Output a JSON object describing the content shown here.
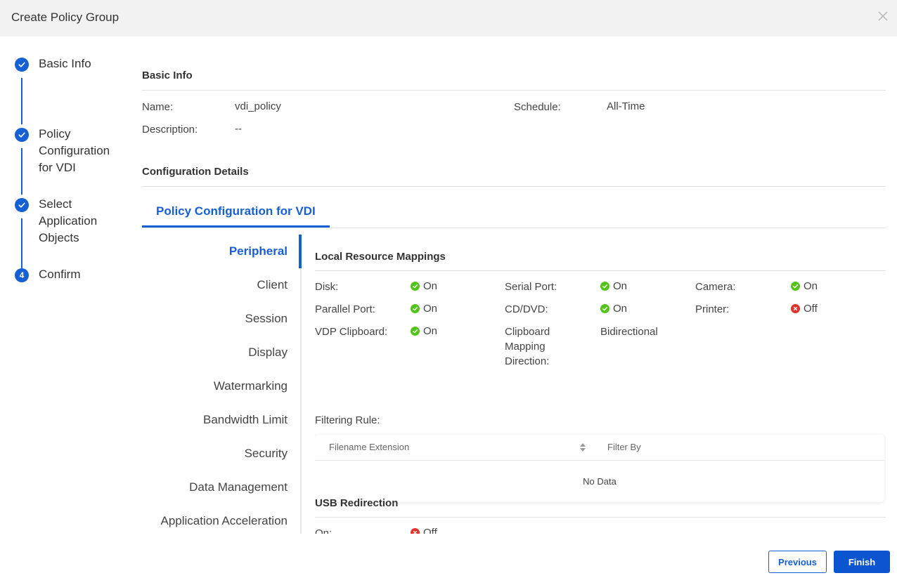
{
  "dialog": {
    "title": "Create Policy Group",
    "close_icon": "close-icon"
  },
  "steps": [
    {
      "label": "Basic Info",
      "state": "done",
      "icon": "check-icon"
    },
    {
      "label": "Policy Configuration for VDI",
      "state": "done",
      "icon": "check-icon"
    },
    {
      "label": "Select Application Objects",
      "state": "done",
      "icon": "check-icon"
    },
    {
      "label": "Confirm",
      "state": "current",
      "number": "4"
    }
  ],
  "basic_info": {
    "title": "Basic Info",
    "name_label": "Name:",
    "name_value": "vdi_policy",
    "schedule_label": "Schedule:",
    "schedule_value": "All-Time",
    "description_label": "Description:",
    "description_value": "--"
  },
  "config_details": {
    "title": "Configuration Details",
    "tab": "Policy Configuration for VDI"
  },
  "side_menu": {
    "items": [
      "Peripheral",
      "Client",
      "Session",
      "Display",
      "Watermarking",
      "Bandwidth Limit",
      "Security",
      "Data Management",
      "Application Acceleration"
    ],
    "active": "Peripheral"
  },
  "local_resource_mappings": {
    "title": "Local Resource Mappings",
    "disk_label": "Disk:",
    "disk_value": "On",
    "serial_port_label": "Serial Port:",
    "serial_port_value": "On",
    "camera_label": "Camera:",
    "camera_value": "On",
    "parallel_port_label": "Parallel Port:",
    "parallel_port_value": "On",
    "cd_dvd_label": "CD/DVD:",
    "cd_dvd_value": "On",
    "printer_label": "Printer:",
    "printer_value": "Off",
    "vdp_clipboard_label": "VDP Clipboard:",
    "vdp_clipboard_value": "On",
    "clipboard_direction_label": "Clipboard Mapping Direction:",
    "clipboard_direction_value": "Bidirectional",
    "filtering_rule_label": "Filtering Rule:",
    "table": {
      "columns": [
        "Filename Extension",
        "Filter By"
      ],
      "empty_text": "No Data",
      "sort_icon": "sort-icon"
    }
  },
  "usb_redirection": {
    "title": "USB Redirection",
    "on_label": "On:",
    "on_value": "Off"
  },
  "footer": {
    "previous_label": "Previous",
    "finish_label": "Finish"
  },
  "colors": {
    "accent": "#1660d6",
    "status_on": "#52c41a",
    "status_off": "#e5312b",
    "header_bg": "#f2f2f2"
  }
}
